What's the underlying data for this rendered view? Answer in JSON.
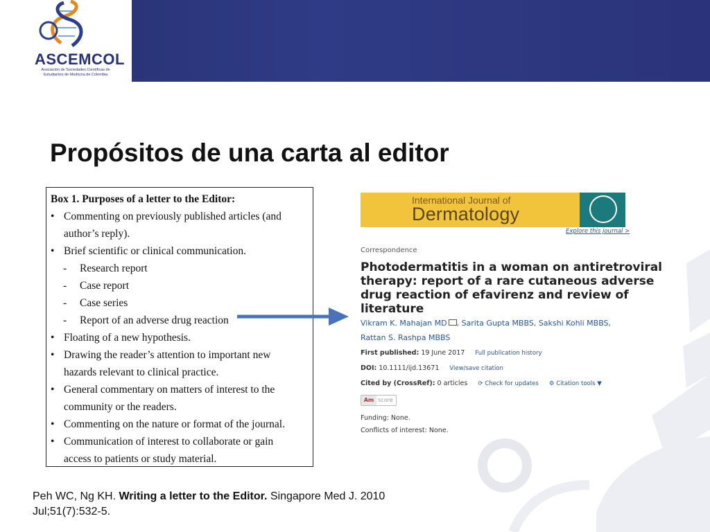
{
  "logo": {
    "name": "ASCEMCOL",
    "subtitle": "Asociación de Sociedades Científicas de Estudiantes de Medicina de Colombia"
  },
  "slide_title": "Propósitos de una carta al editor",
  "box": {
    "title": "Box 1. Purposes of a letter to the Editor:",
    "lines": [
      {
        "marker": "•",
        "text": "Commenting on previously published articles (and",
        "sub": false
      },
      {
        "marker": "",
        "text": "author’s reply).",
        "sub": false
      },
      {
        "marker": "•",
        "text": "Brief scientific or clinical communication.",
        "sub": false
      },
      {
        "marker": "-",
        "text": "Research report",
        "sub": true
      },
      {
        "marker": "-",
        "text": "Case report",
        "sub": true
      },
      {
        "marker": "-",
        "text": "Case series",
        "sub": true
      },
      {
        "marker": "-",
        "text": "Report of an adverse drug reaction",
        "sub": true
      },
      {
        "marker": "•",
        "text": "Floating of a new hypothesis.",
        "sub": false
      },
      {
        "marker": "•",
        "text": "Drawing the reader’s attention to important new",
        "sub": false
      },
      {
        "marker": "",
        "text": "hazards relevant to clinical practice.",
        "sub": false
      },
      {
        "marker": "•",
        "text": "General commentary on matters of interest to the",
        "sub": false
      },
      {
        "marker": "",
        "text": "community or the readers.",
        "sub": false
      },
      {
        "marker": "•",
        "text": "Commenting on the nature or format of the journal.",
        "sub": false
      },
      {
        "marker": "•",
        "text": "Communication of interest to collaborate or gain",
        "sub": false
      },
      {
        "marker": "",
        "text": "access to patients or study material.",
        "sub": false
      }
    ]
  },
  "article": {
    "journal_line1": "International Journal of",
    "journal_line2": "Dermatology",
    "explore": "Explore this journal >",
    "section": "Correspondence",
    "title": "Photodermatitis in a woman on antiretroviral therapy: report of a rare cutaneous adverse drug reaction of efavirenz and review of literature",
    "authors": [
      "Vikram K. Mahajan MD",
      "Sarita Gupta MBBS",
      "Sakshi Kohli MBBS",
      "Rattan S. Rashpa MBBS"
    ],
    "first_published_label": "First published:",
    "first_published_value": "19 June 2017",
    "history_link": "Full publication history",
    "doi_label": "DOI:",
    "doi_value": "10.1111/ijd.13671",
    "citation_link": "View/save citation",
    "cited_label": "Cited by (CrossRef):",
    "cited_value": "0 articles",
    "check_updates": "Check for updates",
    "citation_tools": "Citation tools ▼",
    "altmetric_am": "Am",
    "altmetric_score": "score",
    "funding": "Funding: None.",
    "conflicts": "Conflicts of interest: None."
  },
  "reference": {
    "authors": "Peh WC, Ng KH.",
    "title": "Writing a letter to the Editor.",
    "rest_line1": "Singapore Med J. 2010",
    "line2": "Jul;51(7):532-5."
  },
  "colors": {
    "header": "#2b347a",
    "banner_yellow": "#f2c43c",
    "banner_teal": "#1b7a7c",
    "arrow": "#4a72b8",
    "link_blue": "#2256a3"
  }
}
